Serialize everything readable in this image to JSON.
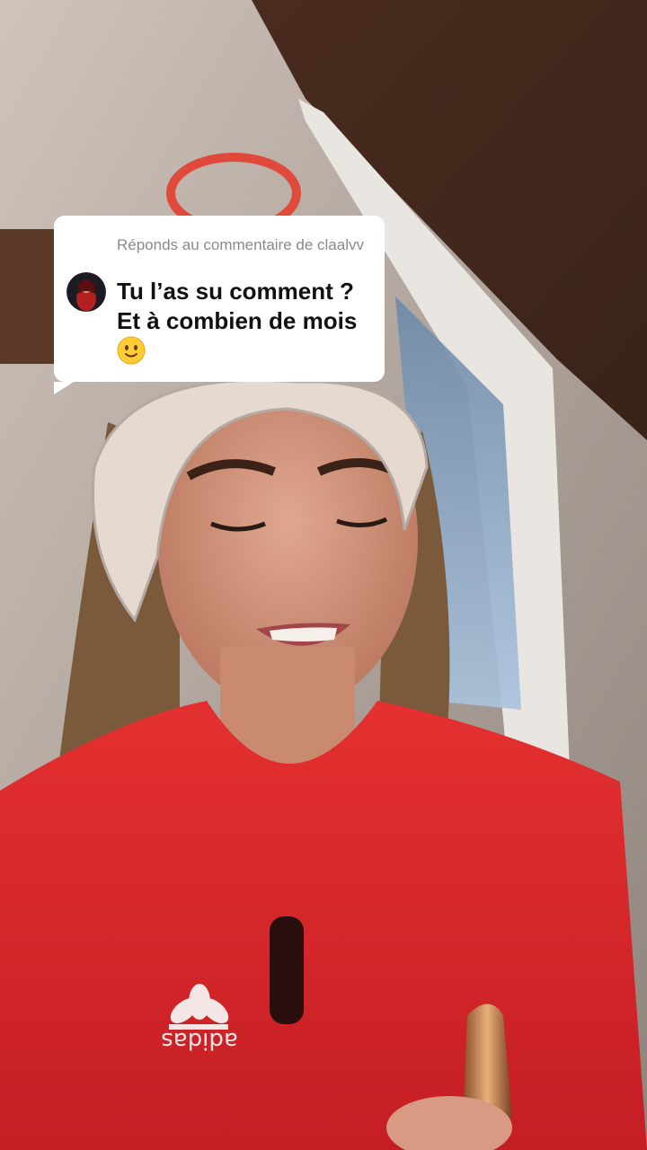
{
  "reply_card": {
    "label": "Réponds au commentaire de claalvv",
    "comment": "Tu l’as su comment ?\nEt à combien de mois",
    "emoji_icon": "slightly-smiling-face-icon"
  },
  "shirt_logo": "adidas",
  "colors": {
    "shirt": "#e02a2a",
    "card_bg": "#ffffff",
    "label_gray": "#8a8a8a"
  }
}
